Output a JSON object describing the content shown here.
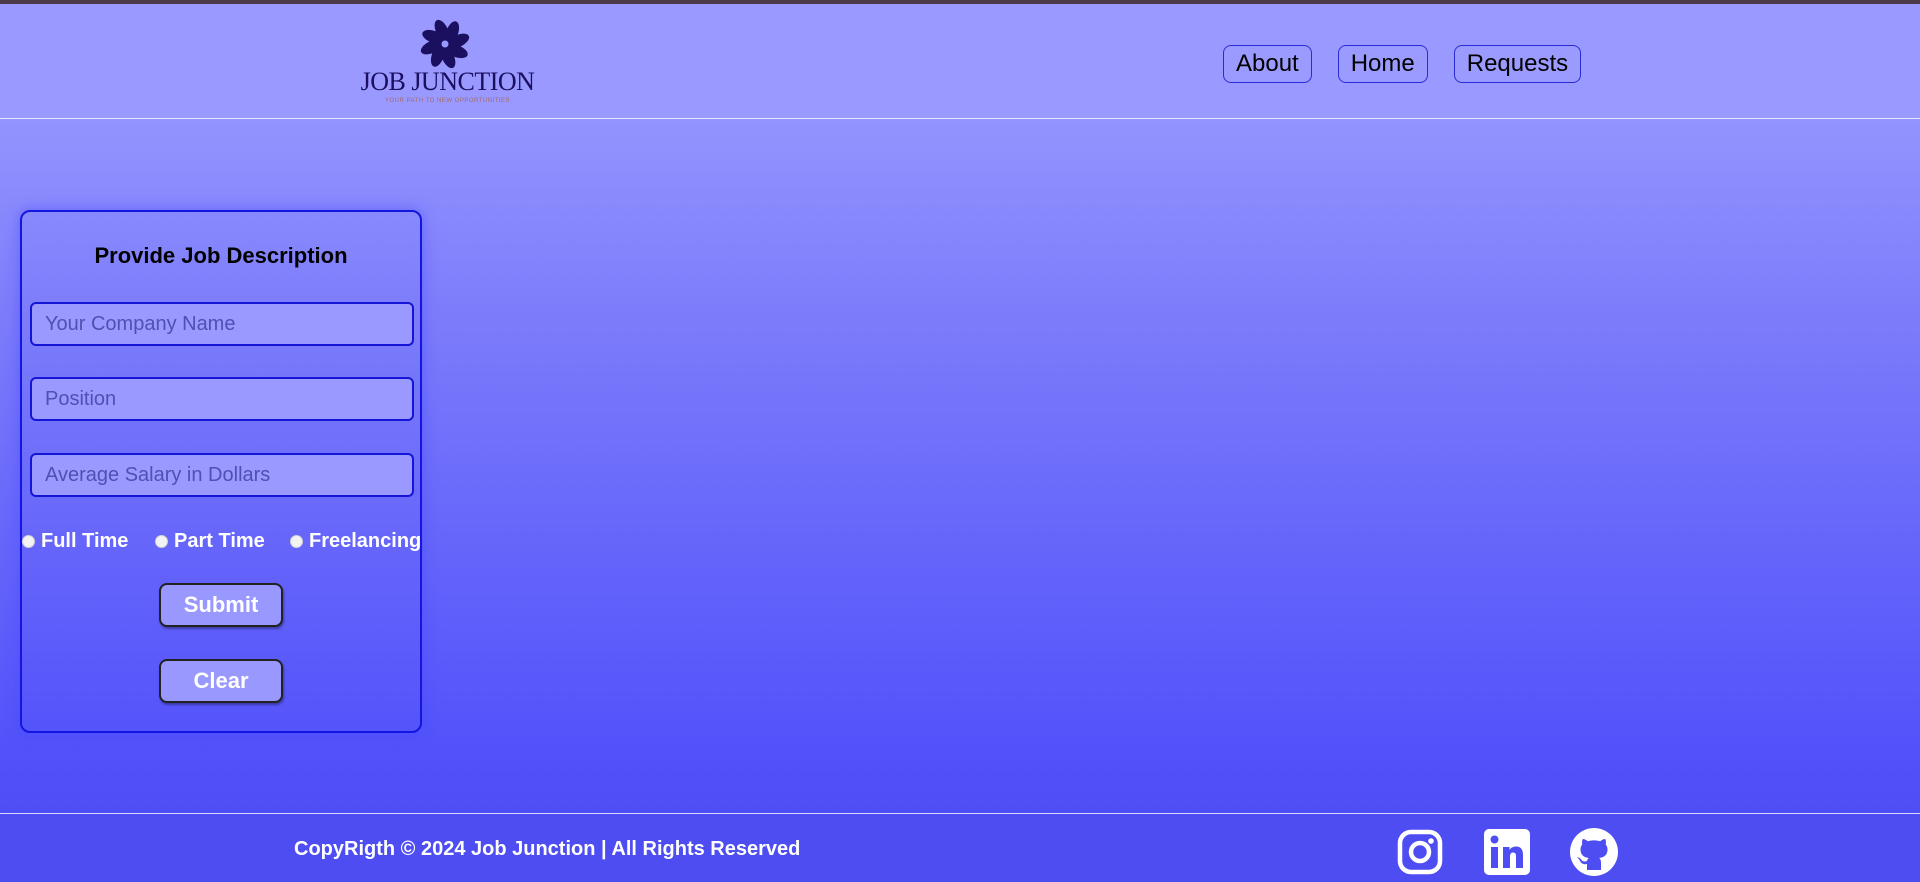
{
  "header": {
    "logo": {
      "title": "JOB JUNCTION",
      "tagline": "YOUR PATH TO NEW OPPORTUNITIES"
    },
    "nav": [
      {
        "label": "About",
        "name": "nav-about-button"
      },
      {
        "label": "Home",
        "name": "nav-home-button"
      },
      {
        "label": "Requests",
        "name": "nav-requests-button"
      }
    ]
  },
  "form": {
    "title": "Provide Job Description",
    "company": {
      "placeholder": "Your Company Name",
      "value": ""
    },
    "position": {
      "placeholder": "Position",
      "value": ""
    },
    "salary": {
      "placeholder": "Average Salary in Dollars",
      "value": ""
    },
    "job_types": [
      "Full Time",
      "Part Time",
      "Freelancing"
    ],
    "submit_label": "Submit",
    "clear_label": "Clear"
  },
  "footer": {
    "copyright": "CopyRigth © 2024 Job Junction | All Rights Reserved",
    "social": [
      "instagram-icon",
      "linkedin-icon",
      "github-icon"
    ]
  },
  "colors": {
    "header_bg": "#9999ff",
    "accent_border": "#1515e0",
    "footer_bg": "#4d4df2",
    "logo_text": "#1b1060"
  }
}
